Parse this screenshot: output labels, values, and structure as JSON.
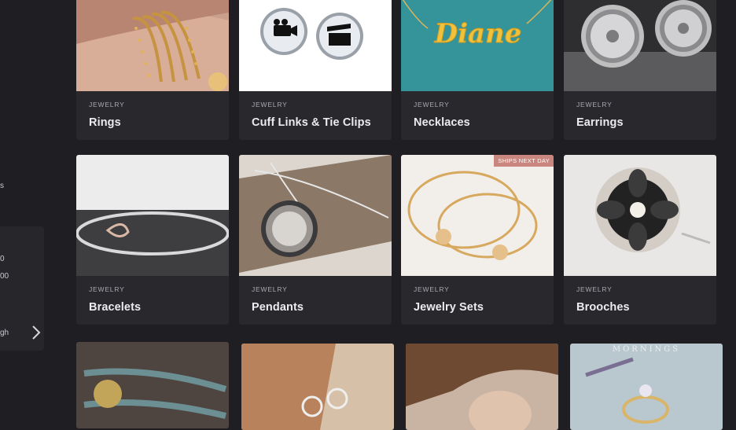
{
  "sidebar": {
    "fragments": [
      "s",
      "0",
      "00",
      "gh"
    ]
  },
  "row1": [
    {
      "category": "JEWELRY",
      "title": "Rings"
    },
    {
      "category": "JEWELRY",
      "title": "Cuff Links & Tie Clips"
    },
    {
      "category": "JEWELRY",
      "title": "Necklaces",
      "image_text": "Diane"
    },
    {
      "category": "JEWELRY",
      "title": "Earrings"
    }
  ],
  "row2": [
    {
      "category": "JEWELRY",
      "title": "Bracelets"
    },
    {
      "category": "JEWELRY",
      "title": "Pendants"
    },
    {
      "category": "JEWELRY",
      "title": "Jewelry Sets",
      "badge": "SHIPS NEXT DAY"
    },
    {
      "category": "JEWELRY",
      "title": "Brooches"
    }
  ],
  "row3_image_text": "MORNINGS",
  "colors": {
    "background": "#1f1f23",
    "card": "#28282d",
    "badge": "#c9867e"
  }
}
